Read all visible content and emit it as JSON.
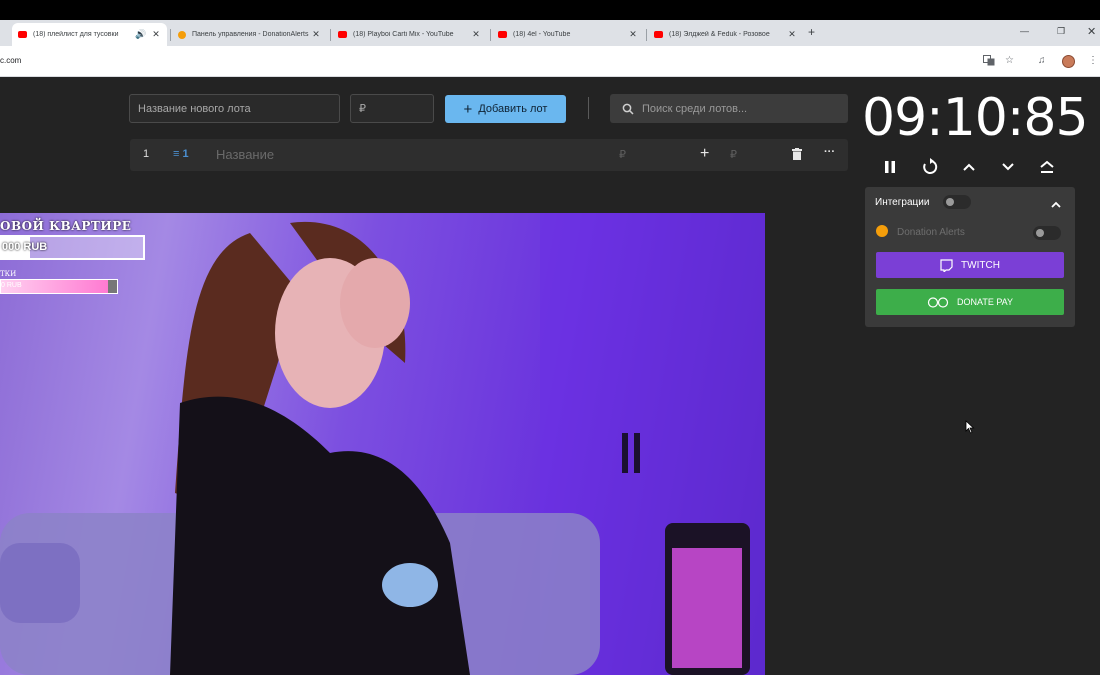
{
  "browser": {
    "tabs": [
      {
        "title": "(18) плейлист для тусовки",
        "icon": "youtube-icon",
        "active": true,
        "audio": true
      },
      {
        "title": "Панель управления - DonationAlerts",
        "icon": "donationalerts-icon",
        "active": false
      },
      {
        "title": "(18) Playboi Carti Mix - YouTube",
        "icon": "youtube-icon",
        "active": false
      },
      {
        "title": "(18) 4el - YouTube",
        "icon": "youtube-icon",
        "active": false
      },
      {
        "title": "(18) Элджей & Feduk - Розовое",
        "icon": "youtube-icon",
        "active": false
      }
    ],
    "new_tab": "+",
    "close_glyph": "✕",
    "url": "c.com"
  },
  "lot_form": {
    "name_placeholder": "Название нового лота",
    "price_placeholder": "₽",
    "add_button": "Добавить лот",
    "search_placeholder": "Поиск среди лотов..."
  },
  "lot": {
    "index": "1",
    "badge": "≡ 1",
    "name": "Название",
    "price": "₽",
    "plus": "+",
    "add_price": "₽",
    "more": "···"
  },
  "timer": {
    "value": "09:10:85"
  },
  "integrations": {
    "title": "Интеграции",
    "donation_alerts": "Donation Alerts",
    "twitch": "TWITCH",
    "donatepay": "DONATE PAY"
  },
  "stream": {
    "goal_title": "ОВОЙ КВАРТИРЕ",
    "goal_amount": "000 RUB",
    "goal_progress": 0.2,
    "sub_title": "ТКИ",
    "sub_amount": "0 RUB",
    "sub_progress": 0.92
  },
  "colors": {
    "accent_blue": "#6ab7ef",
    "twitch_purple": "#7b3fd6",
    "donatepay_green": "#3dae4a",
    "donation_alerts_orange": "#f59e0b"
  }
}
